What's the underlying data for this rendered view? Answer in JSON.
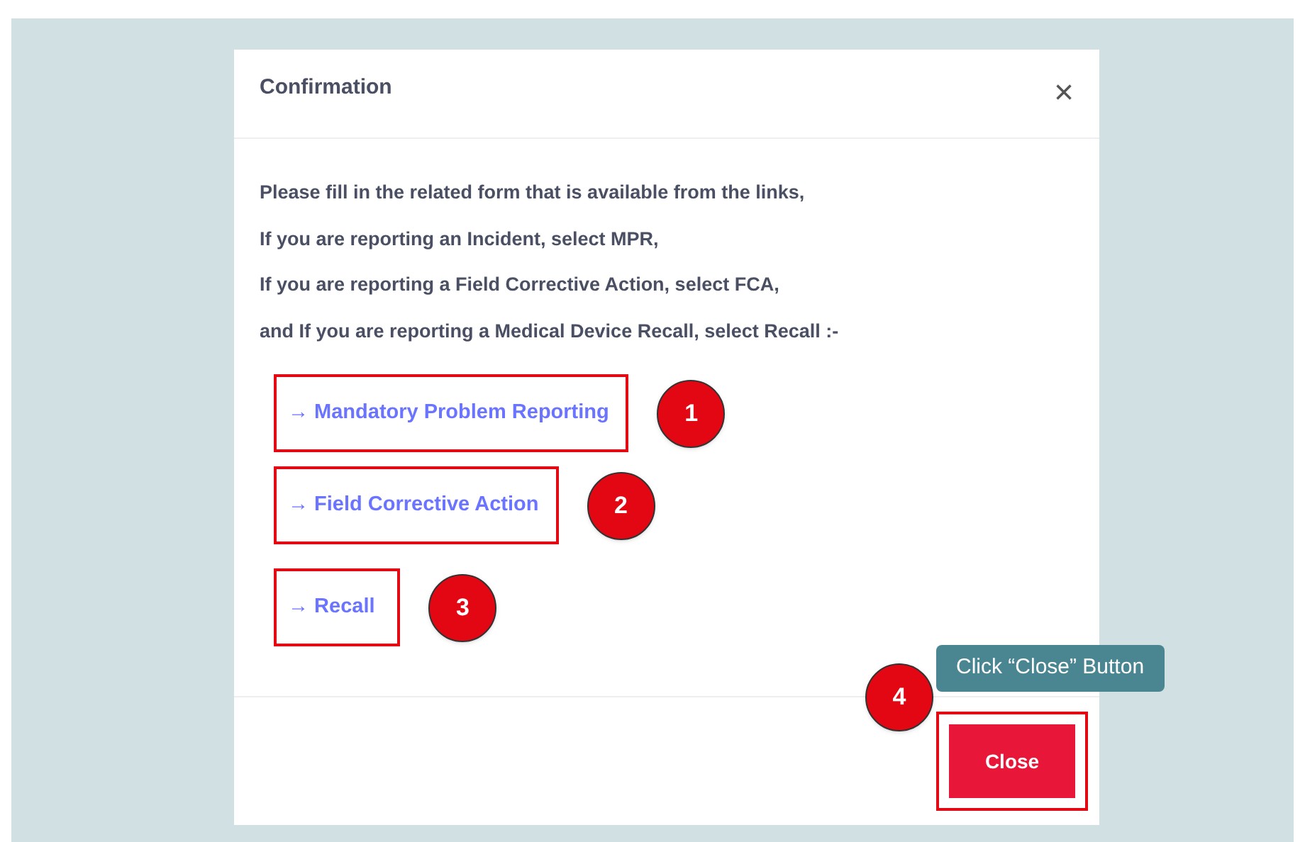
{
  "dialog": {
    "title": "Confirmation",
    "close_icon": "×",
    "message_lines": [
      "Please fill in the related form that is available from the links,",
      "If you are reporting an Incident, select MPR,",
      "If you are reporting a Field Corrective Action, select FCA,",
      "and If you are reporting a Medical Device Recall, select Recall :-"
    ],
    "links": [
      {
        "arrow": "→",
        "label": "Mandatory Problem Reporting",
        "step": "1"
      },
      {
        "arrow": "→",
        "label": "Field Corrective Action",
        "step": "2"
      },
      {
        "arrow": "→",
        "label": "Recall",
        "step": "3"
      }
    ],
    "footer": {
      "button": "Close",
      "step": "4",
      "tooltip": "Click “Close” Button"
    }
  }
}
